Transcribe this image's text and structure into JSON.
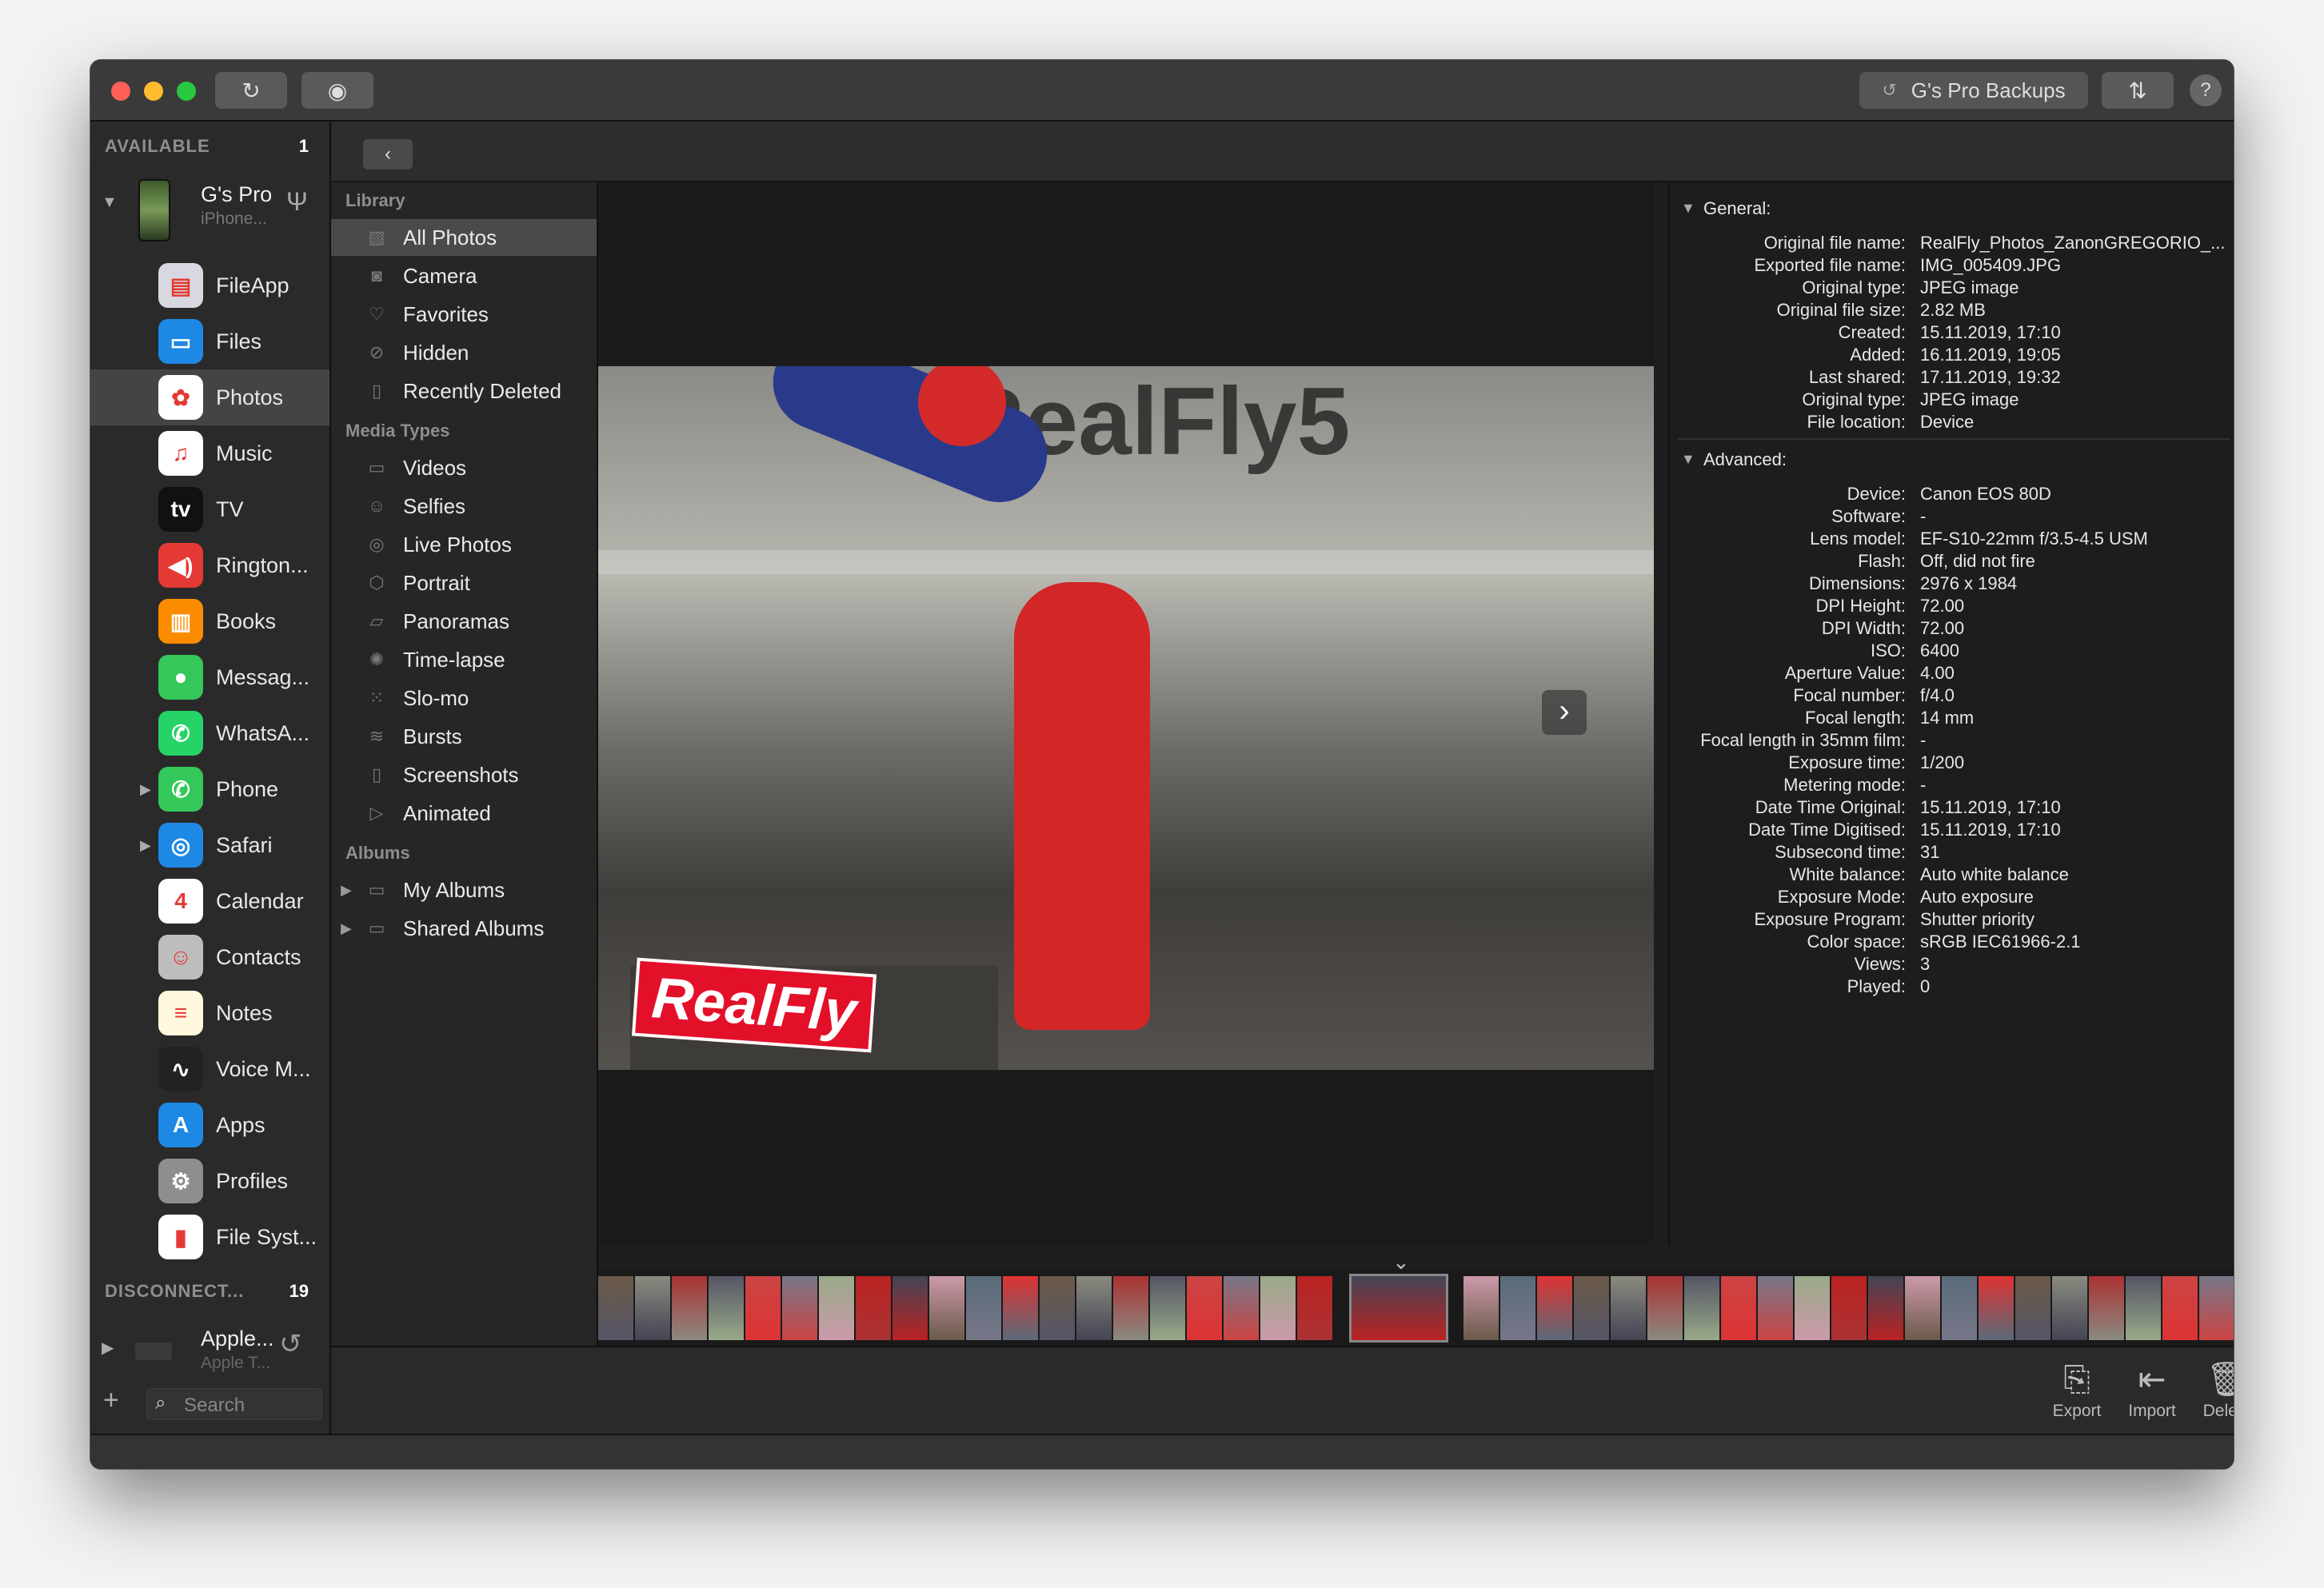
{
  "window": {
    "backup_label": "G's Pro Backups",
    "help": "?"
  },
  "sidebar": {
    "available_label": "AVAILABLE",
    "available_count": "1",
    "device": {
      "name": "G's Pro",
      "subtitle": "iPhone..."
    },
    "apps": [
      {
        "label": "FileApp",
        "icon": "fileapp-icon",
        "color": "#d8d8e0",
        "glyph": "▤"
      },
      {
        "label": "Files",
        "icon": "files-icon",
        "color": "#1e88e5",
        "glyph": "▭"
      },
      {
        "label": "Photos",
        "icon": "photos-icon",
        "color": "#ffffff",
        "glyph": "✿",
        "selected": true
      },
      {
        "label": "Music",
        "icon": "music-icon",
        "color": "#ffffff",
        "glyph": "♫"
      },
      {
        "label": "TV",
        "icon": "tv-icon",
        "color": "#111111",
        "glyph": "tv"
      },
      {
        "label": "Rington...",
        "icon": "ringtones-icon",
        "color": "#e53935",
        "glyph": "◀)"
      },
      {
        "label": "Books",
        "icon": "books-icon",
        "color": "#fb8c00",
        "glyph": "▥"
      },
      {
        "label": "Messag...",
        "icon": "messages-icon",
        "color": "#34c759",
        "glyph": "●"
      },
      {
        "label": "WhatsA...",
        "icon": "whatsapp-icon",
        "color": "#25d366",
        "glyph": "✆"
      },
      {
        "label": "Phone",
        "icon": "phone-icon",
        "color": "#34c759",
        "glyph": "✆",
        "disclosure": true
      },
      {
        "label": "Safari",
        "icon": "safari-icon",
        "color": "#1e88e5",
        "glyph": "◎",
        "disclosure": true
      },
      {
        "label": "Calendar",
        "icon": "calendar-icon",
        "color": "#ffffff",
        "glyph": "4"
      },
      {
        "label": "Contacts",
        "icon": "contacts-icon",
        "color": "#bdbdbd",
        "glyph": "☺"
      },
      {
        "label": "Notes",
        "icon": "notes-icon",
        "color": "#fff8dc",
        "glyph": "≡"
      },
      {
        "label": "Voice M...",
        "icon": "voice-memos-icon",
        "color": "#222222",
        "glyph": "∿"
      },
      {
        "label": "Apps",
        "icon": "app-store-icon",
        "color": "#1e88e5",
        "glyph": "A"
      },
      {
        "label": "Profiles",
        "icon": "profiles-icon",
        "color": "#8e8e8e",
        "glyph": "⚙"
      },
      {
        "label": "File Syst...",
        "icon": "file-system-icon",
        "color": "#ffffff",
        "glyph": "▮"
      }
    ],
    "disconnected_label": "DISCONNECT...",
    "disconnected_count": "19",
    "disconnected_device": {
      "name": "Apple...",
      "subtitle": "Apple T..."
    },
    "search_placeholder": "Search"
  },
  "library": {
    "sections": [
      {
        "title": "Library",
        "items": [
          {
            "label": "All Photos",
            "icon": "all-photos-icon",
            "glyph": "▨",
            "selected": true
          },
          {
            "label": "Camera",
            "icon": "camera-icon",
            "glyph": "◙"
          },
          {
            "label": "Favorites",
            "icon": "heart-icon",
            "glyph": "♡"
          },
          {
            "label": "Hidden",
            "icon": "hidden-icon",
            "glyph": "⊘"
          },
          {
            "label": "Recently Deleted",
            "icon": "trash-icon",
            "glyph": "▯"
          }
        ]
      },
      {
        "title": "Media Types",
        "items": [
          {
            "label": "Videos",
            "icon": "videos-icon",
            "glyph": "▭"
          },
          {
            "label": "Selfies",
            "icon": "selfies-icon",
            "glyph": "☺"
          },
          {
            "label": "Live Photos",
            "icon": "live-photos-icon",
            "glyph": "◎"
          },
          {
            "label": "Portrait",
            "icon": "portrait-icon",
            "glyph": "⬡"
          },
          {
            "label": "Panoramas",
            "icon": "panoramas-icon",
            "glyph": "▱"
          },
          {
            "label": "Time-lapse",
            "icon": "time-lapse-icon",
            "glyph": "✺"
          },
          {
            "label": "Slo-mo",
            "icon": "slo-mo-icon",
            "glyph": "⁙"
          },
          {
            "label": "Bursts",
            "icon": "bursts-icon",
            "glyph": "≋"
          },
          {
            "label": "Screenshots",
            "icon": "screenshots-icon",
            "glyph": "▯"
          },
          {
            "label": "Animated",
            "icon": "animated-icon",
            "glyph": "▷"
          }
        ]
      },
      {
        "title": "Albums",
        "items": [
          {
            "label": "My Albums",
            "icon": "folder-icon",
            "glyph": "▭",
            "disclosure": true
          },
          {
            "label": "Shared Albums",
            "icon": "folder-icon",
            "glyph": "▭",
            "disclosure": true
          }
        ]
      }
    ]
  },
  "viewer": {
    "logo_text": "RealFly",
    "backdrop_text": "#RealFly5"
  },
  "info": {
    "general_title": "General:",
    "general": [
      [
        "Original file name:",
        "RealFly_Photos_ZanonGREGORIO_..."
      ],
      [
        "Exported file name:",
        "IMG_005409.JPG"
      ],
      [
        "Original type:",
        "JPEG image"
      ],
      [
        "Original file size:",
        "2.82 MB"
      ],
      [
        "Created:",
        "15.11.2019, 17:10"
      ],
      [
        "Added:",
        "16.11.2019, 19:05"
      ],
      [
        "Last shared:",
        "17.11.2019, 19:32"
      ],
      [
        "Original type:",
        "JPEG image"
      ],
      [
        "File location:",
        "Device"
      ]
    ],
    "advanced_title": "Advanced:",
    "advanced": [
      [
        "Device:",
        "Canon EOS 80D"
      ],
      [
        "Software:",
        "-"
      ],
      [
        "Lens model:",
        "EF-S10-22mm f/3.5-4.5 USM"
      ],
      [
        "Flash:",
        "Off, did not fire"
      ],
      [
        "Dimensions:",
        "2976 x 1984"
      ],
      [
        "DPI Height:",
        "72.00"
      ],
      [
        "DPI Width:",
        "72.00"
      ],
      [
        "ISO:",
        "6400"
      ],
      [
        "Aperture Value:",
        "4.00"
      ],
      [
        "Focal number:",
        "f/4.0"
      ],
      [
        "Focal length:",
        "14 mm"
      ],
      [
        "Focal length in 35mm film:",
        "-"
      ],
      [
        "Exposure time:",
        "1/200"
      ],
      [
        "Metering mode:",
        "-"
      ],
      [
        "Date Time Original:",
        "15.11.2019, 17:10"
      ],
      [
        "Date Time Digitised:",
        "15.11.2019, 17:10"
      ],
      [
        "Subsecond time:",
        "31"
      ],
      [
        "White balance:",
        "Auto white balance"
      ],
      [
        "Exposure Mode:",
        "Auto exposure"
      ],
      [
        "Exposure Program:",
        "Shutter priority"
      ],
      [
        "Color space:",
        "sRGB IEC61966-2.1"
      ],
      [
        "Views:",
        "3"
      ],
      [
        "Played:",
        "0"
      ]
    ]
  },
  "actions": {
    "export": "Export",
    "import": "Import",
    "delete": "Delete"
  }
}
